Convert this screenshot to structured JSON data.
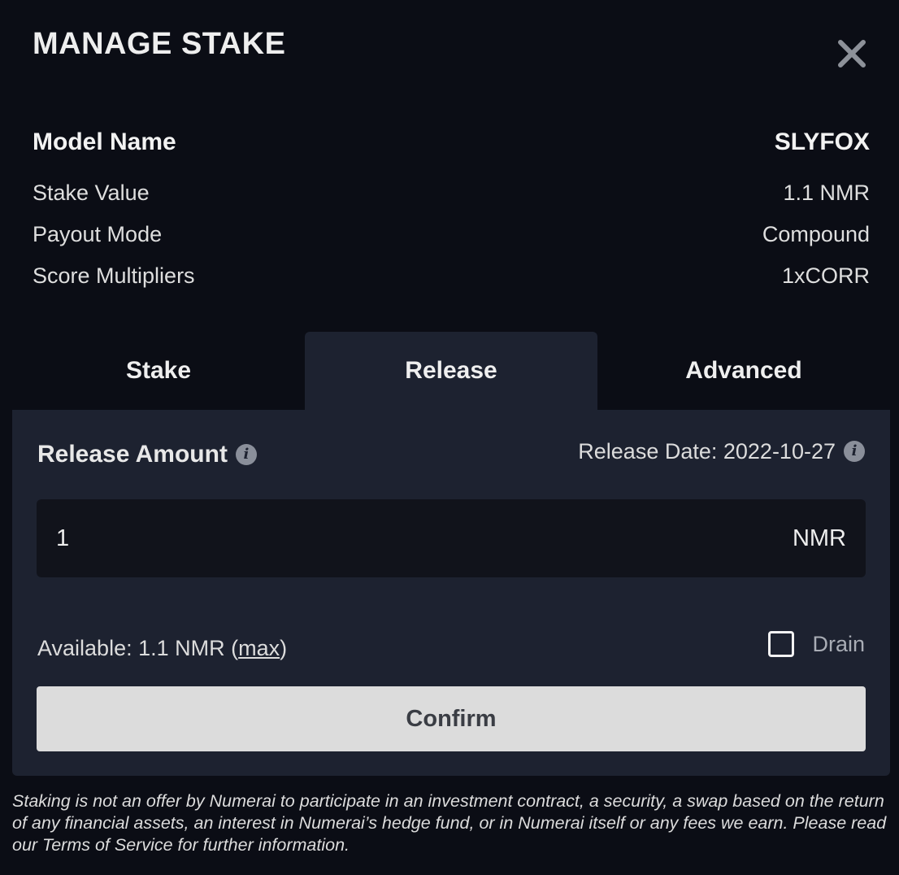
{
  "header": {
    "title": "MANAGE STAKE"
  },
  "model": {
    "name_label": "Model Name",
    "name_value": "SLYFOX",
    "stake_value_label": "Stake Value",
    "stake_value": "1.1 NMR",
    "payout_mode_label": "Payout Mode",
    "payout_mode": "Compound",
    "score_multipliers_label": "Score Multipliers",
    "score_multipliers": "1xCORR"
  },
  "tabs": [
    {
      "label": "Stake",
      "active": false
    },
    {
      "label": "Release",
      "active": true
    },
    {
      "label": "Advanced",
      "active": false
    }
  ],
  "release": {
    "amount_label": "Release Amount",
    "date_text": "Release Date: 2022-10-27",
    "amount_value": "1",
    "unit": "NMR",
    "available_prefix": "Available: 1.1 NMR (",
    "max_label": "max",
    "available_suffix": ")",
    "drain_label": "Drain",
    "drain_checked": false,
    "confirm_label": "Confirm"
  },
  "disclaimer": "Staking is not an offer by Numerai to participate in an investment contract, a security, a swap based on the return of any financial assets, an interest in Numerai’s hedge fund, or in Numerai itself or any fees we earn. Please read our Terms of Service for further information.",
  "colors": {
    "background": "#0b0d15",
    "panel": "#1d2230",
    "input": "#11131b",
    "button": "#dcdcdc",
    "text": "#e6e6e6"
  },
  "icons": {
    "close": "close-icon",
    "info": "info-icon",
    "checkbox": "checkbox-icon"
  }
}
